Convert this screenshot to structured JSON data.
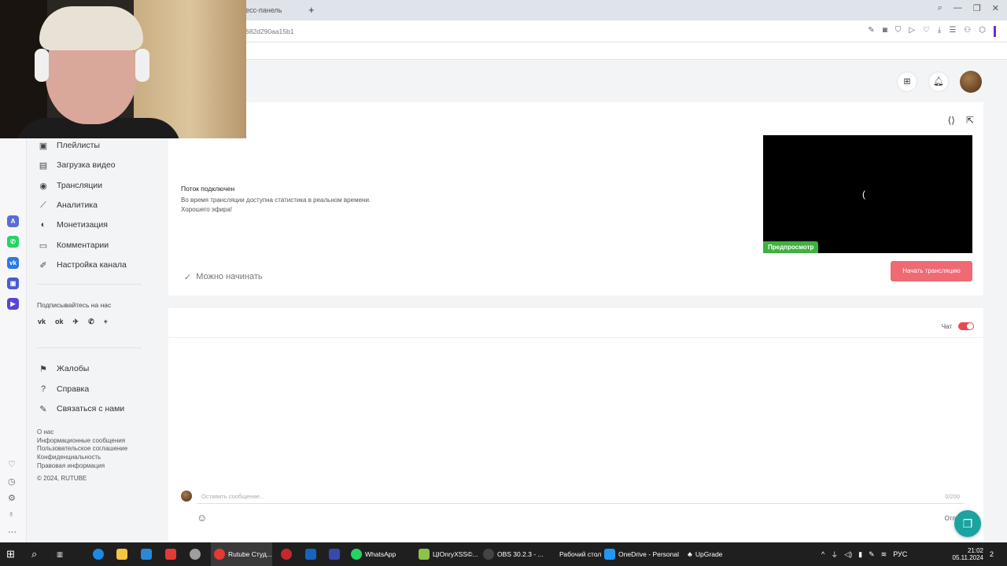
{
  "browser": {
    "tab_title": "есс-панель",
    "url": "682d290aa15b1"
  },
  "sidebar": {
    "items": [
      {
        "label": "Плейлисты",
        "icon": "playlist-icon"
      },
      {
        "label": "Загрузка видео",
        "icon": "upload-icon"
      },
      {
        "label": "Трансляции",
        "icon": "broadcast-icon"
      },
      {
        "label": "Аналитика",
        "icon": "analytics-icon"
      },
      {
        "label": "Монетизация",
        "icon": "monetization-icon"
      },
      {
        "label": "Комментарии",
        "icon": "comments-icon"
      },
      {
        "label": "Настройка канала",
        "icon": "settings-icon"
      }
    ],
    "follow_label": "Подписывайтесь на нас",
    "social": [
      "vk",
      "ok",
      "telegram",
      "viber",
      "more"
    ],
    "support_items": [
      {
        "label": "Жалобы",
        "icon": "flag-icon"
      },
      {
        "label": "Справка",
        "icon": "help-icon"
      },
      {
        "label": "Связаться с нами",
        "icon": "contact-icon"
      }
    ],
    "footer_links": [
      "О нас",
      "Информационные сообщения",
      "Пользовательское соглашение",
      "Конфиденциальность",
      "Правовая информация"
    ],
    "copyright": "© 2024, RUTUBE"
  },
  "stream": {
    "status_title": "Поток подключен",
    "status_line1": "Во время трансляции доступна статистика в реальном времени.",
    "status_line2": "Хорошего эфира!",
    "ready_label": "Можно начинать",
    "preview_badge": "Предпросмотр",
    "start_button": "Начать трансляцию"
  },
  "chat": {
    "label": "Чат",
    "enabled": true,
    "input_placeholder": "Оставить сообщение...",
    "counter": "0/200",
    "send_label": "Отправ"
  },
  "taskbar": {
    "items": [
      {
        "label": "Rutube Студ...",
        "color": "#e53935"
      },
      {
        "label": "WhatsApp",
        "color": "#25d366"
      },
      {
        "label": "ЦIОnryXSS©...",
        "color": "#8bc34a"
      },
      {
        "label": "OBS 30.2.3 - ...",
        "color": "#333333"
      }
    ],
    "desktop_label": "Рабочий стол",
    "onedrive_label": "OneDrive - Personal",
    "upgrade_label": "UpGrade",
    "lang": "РУС",
    "time": "21:02",
    "date": "05.11.2024",
    "notif_count": "2"
  },
  "colors": {
    "accent": "#ef6a73",
    "toggle": "#e8484f",
    "preview_badge": "#3fb13f"
  }
}
